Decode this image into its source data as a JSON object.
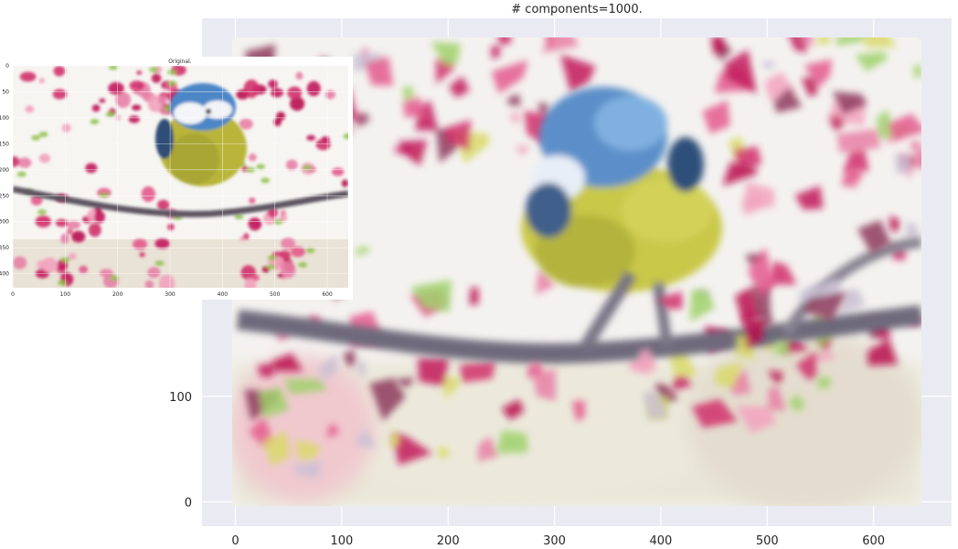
{
  "chart_data": [
    {
      "type": "image",
      "title": "# components=1000.",
      "xlabel": "",
      "ylabel": "",
      "x_ticks": [
        0,
        100,
        200,
        300,
        400,
        500,
        600
      ],
      "y_ticks": [
        0,
        100
      ],
      "xlim": [
        -3,
        645
      ],
      "ylim": [
        -4,
        440
      ],
      "grid": true,
      "background": "#eaeaf2",
      "image_content": "low-poly triangle mosaic of a blue tit on a flowering branch",
      "colors": {
        "pink": "#d0306a",
        "magenta": "#c2185b",
        "yellow": "#c9c84a",
        "blue": "#5b8fc9",
        "branch": "#6e6a7c"
      }
    },
    {
      "type": "image",
      "title": "Original.",
      "xlabel": "",
      "ylabel": "",
      "x_ticks": [
        0,
        100,
        200,
        300,
        400,
        500,
        600
      ],
      "y_ticks": [
        0,
        50,
        100,
        150,
        200,
        250,
        300,
        350,
        400
      ],
      "xlim": [
        0,
        640
      ],
      "ylim": [
        427,
        0
      ],
      "grid": true,
      "image_content": "photo of a blue tit perched on a branch with pink blossoms"
    }
  ]
}
